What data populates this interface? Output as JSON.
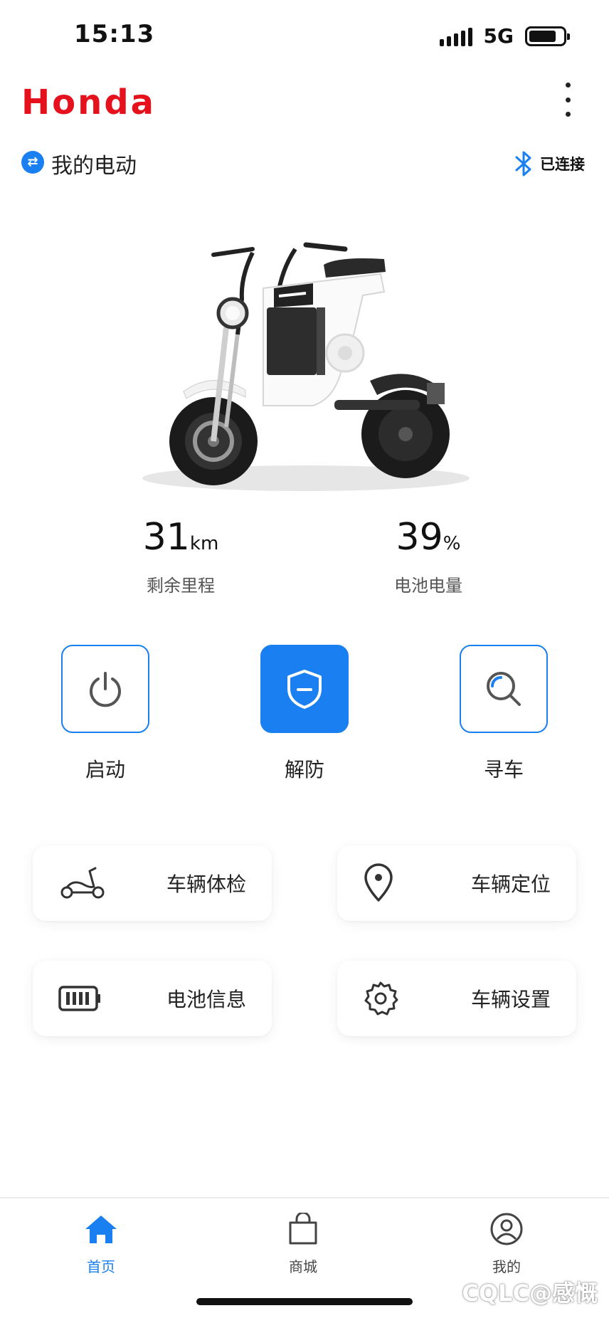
{
  "status_bar": {
    "time": "15:13",
    "network": "5G",
    "battery_level": 0.8
  },
  "header": {
    "brand": "Honda"
  },
  "vehicle": {
    "name": "我的电动",
    "bluetooth_status": "已连接"
  },
  "stats": {
    "range": {
      "value": "31",
      "unit": "km",
      "label": "剩余里程"
    },
    "battery": {
      "value": "39",
      "unit": "%",
      "label": "电池电量"
    }
  },
  "actions": {
    "start": {
      "label": "启动"
    },
    "disarm": {
      "label": "解防"
    },
    "find": {
      "label": "寻车"
    }
  },
  "features": {
    "checkup": {
      "label": "车辆体检"
    },
    "location": {
      "label": "车辆定位"
    },
    "battery_info": {
      "label": "电池信息"
    },
    "settings": {
      "label": "车辆设置"
    }
  },
  "nav": {
    "home": {
      "label": "首页"
    },
    "store": {
      "label": "商城"
    },
    "mine": {
      "label": "我的"
    }
  },
  "watermark": "CQLC@感慨",
  "colors": {
    "accent": "#1a7ff0",
    "brand": "#e5121e"
  }
}
